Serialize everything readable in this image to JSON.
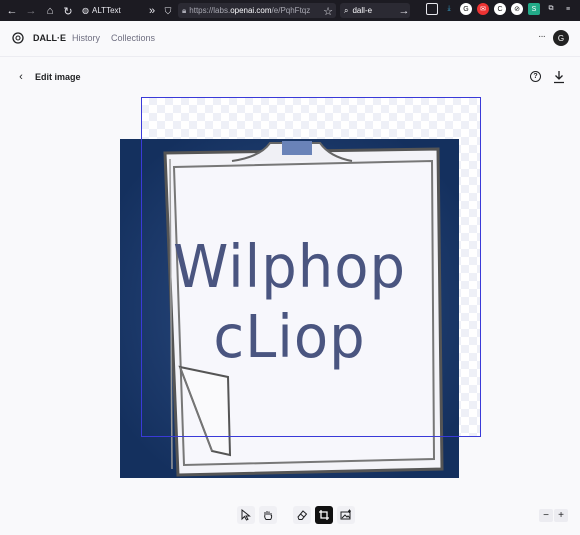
{
  "browser": {
    "bookmark_label": "ALTText",
    "url_prefix": "https://labs.",
    "url_domain": "openai.com",
    "url_rest": "/e/PqhFtqz",
    "search_text": "dall-e"
  },
  "app": {
    "brand": "DALL·E",
    "nav": [
      "History",
      "Collections"
    ],
    "more": "···",
    "avatar_initial": "G"
  },
  "editor": {
    "title": "Edit image",
    "help": "?",
    "artwork_text_line1": "Wilphop",
    "artwork_text_line2": "cLiop"
  },
  "zoom": {
    "minus": "−",
    "plus": "+"
  },
  "colors": {
    "frame": "#3a3ad8",
    "art_background": "#1e3a6e",
    "active_tool": "#111111"
  }
}
